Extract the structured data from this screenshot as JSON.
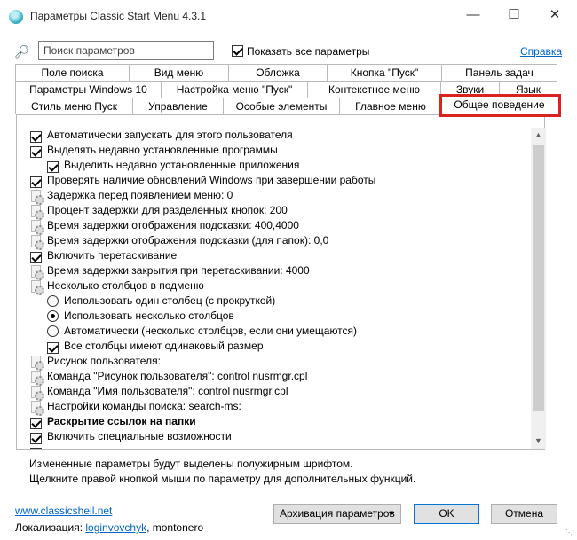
{
  "window": {
    "title": "Параметры Classic Start Menu 4.3.1",
    "min_glyph": "—",
    "max_glyph": "☐",
    "close_glyph": "✕"
  },
  "search": {
    "placeholder": "Поиск параметров",
    "value": "",
    "show_all_label": "Показать все параметры",
    "show_all_checked": true,
    "help_link": "Справка"
  },
  "tabs": {
    "row1": [
      "Поле поиска",
      "Вид меню",
      "Обложка",
      "Кнопка \"Пуск\"",
      "Панель задач"
    ],
    "row2": [
      "Параметры Windows 10",
      "Настройка меню \"Пуск\"",
      "Контекстное меню",
      "Звуки",
      "Язык"
    ],
    "row3": [
      "Стиль меню Пуск",
      "Управление",
      "Особые элементы",
      "Главное меню",
      "Общее поведение"
    ],
    "active": "Общее поведение"
  },
  "settings": [
    {
      "type": "checkbox",
      "checked": true,
      "indent": 0,
      "label": "Автоматически запускать для этого пользователя"
    },
    {
      "type": "checkbox",
      "checked": true,
      "indent": 0,
      "label": "Выделять недавно установленные программы"
    },
    {
      "type": "checkbox",
      "checked": true,
      "indent": 1,
      "label": "Выделить недавно установленные приложения"
    },
    {
      "type": "checkbox",
      "checked": true,
      "indent": 0,
      "label": "Проверять наличие обновлений Windows при завершении работы"
    },
    {
      "type": "setting",
      "indent": 0,
      "label": "Задержка перед появлением меню: 0"
    },
    {
      "type": "setting",
      "indent": 0,
      "label": "Процент задержки для разделенных кнопок: 200"
    },
    {
      "type": "setting",
      "indent": 0,
      "label": "Время задержки отображения подсказки: 400,4000"
    },
    {
      "type": "setting",
      "indent": 0,
      "label": "Время задержки отображения подсказки (для папок): 0,0"
    },
    {
      "type": "checkbox",
      "checked": true,
      "indent": 0,
      "label": "Включить перетаскивание"
    },
    {
      "type": "setting",
      "indent": 0,
      "label": "Время задержки закрытия при перетаскивании: 4000"
    },
    {
      "type": "setting",
      "indent": 0,
      "label": "Несколько столбцов в подменю"
    },
    {
      "type": "radio",
      "checked": false,
      "indent": 1,
      "label": "Использовать один столбец (с прокруткой)"
    },
    {
      "type": "radio",
      "checked": true,
      "indent": 1,
      "label": "Использовать несколько столбцов"
    },
    {
      "type": "radio",
      "checked": false,
      "indent": 1,
      "label": "Автоматически (несколько столбцов, если они умещаются)"
    },
    {
      "type": "checkbox",
      "checked": true,
      "indent": 1,
      "label": "Все столбцы имеют одинаковый размер"
    },
    {
      "type": "setting",
      "indent": 0,
      "label": "Рисунок пользователя:"
    },
    {
      "type": "setting",
      "indent": 0,
      "label": "Команда \"Рисунок пользователя\": control nusrmgr.cpl"
    },
    {
      "type": "setting",
      "indent": 0,
      "label": "Команда \"Имя пользователя\": control nusrmgr.cpl"
    },
    {
      "type": "setting",
      "indent": 0,
      "label": "Настройки команды поиска: search-ms:"
    },
    {
      "type": "checkbox",
      "checked": true,
      "indent": 0,
      "bold": true,
      "label": "Раскрытие ссылок на папки"
    },
    {
      "type": "checkbox",
      "checked": true,
      "indent": 0,
      "label": "Включить специальные возможности"
    },
    {
      "type": "checkbox",
      "checked": true,
      "indent": 0,
      "label": ""
    }
  ],
  "hints": {
    "line1": "Измененные параметры будут выделены полужирным шрифтом.",
    "line2": "Щелкните правой кнопкой мыши по параметру для дополнительных функций."
  },
  "footer": {
    "website": "www.classicshell.net",
    "localization_label": "Локализация:",
    "localizer_link": "loginvovchyk",
    "localizer_rest": ", montonero",
    "backup_button": "Архивация параметров",
    "ok_button": "OK",
    "cancel_button": "Отмена"
  }
}
